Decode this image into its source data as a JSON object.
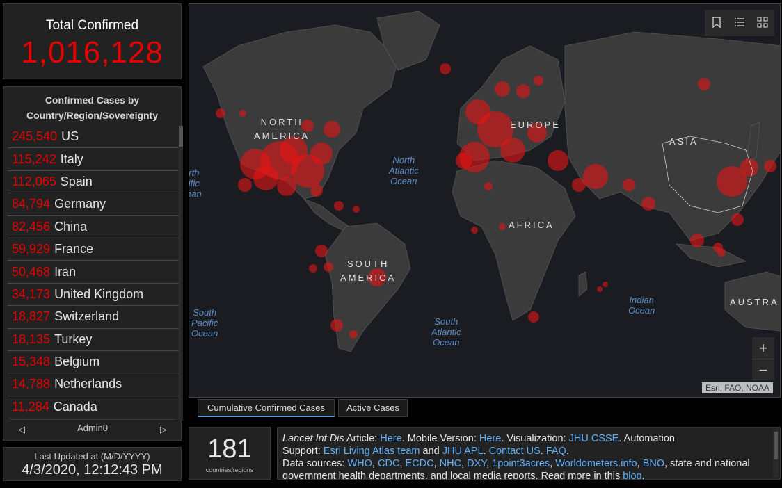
{
  "total": {
    "label": "Total Confirmed",
    "value": "1,016,128"
  },
  "country_list": {
    "header": "Confirmed Cases by Country/Region/Sovereignty",
    "rows": [
      {
        "count": "245,540",
        "name": "US"
      },
      {
        "count": "115,242",
        "name": "Italy"
      },
      {
        "count": "112,065",
        "name": "Spain"
      },
      {
        "count": "84,794",
        "name": "Germany"
      },
      {
        "count": "82,456",
        "name": "China"
      },
      {
        "count": "59,929",
        "name": "France"
      },
      {
        "count": "50,468",
        "name": "Iran"
      },
      {
        "count": "34,173",
        "name": "United Kingdom"
      },
      {
        "count": "18,827",
        "name": "Switzerland"
      },
      {
        "count": "18,135",
        "name": "Turkey"
      },
      {
        "count": "15,348",
        "name": "Belgium"
      },
      {
        "count": "14,788",
        "name": "Netherlands"
      },
      {
        "count": "11,284",
        "name": "Canada"
      }
    ],
    "pager_label": "Admin0"
  },
  "last_updated": {
    "label": "Last Updated at (M/D/YYYY)",
    "value": "4/3/2020, 12:12:43 PM"
  },
  "map": {
    "continent_labels": {
      "north_america": "NORTH AMERICA",
      "south_america": "SOUTH AMERICA",
      "europe": "EUROPE",
      "asia": "ASIA",
      "africa": "AFRICA",
      "australia": "AUSTRA"
    },
    "ocean_labels": {
      "north_atlantic": "North\nAtlantic\nOcean",
      "south_atlantic": "South\nAtlantic\nOcean",
      "south_pacific": "South\nPacific\nOcean",
      "north_pacific": "rth\nific\nean",
      "indian": "Indian\nOcean"
    },
    "attribution": "Esri, FAO, NOAA",
    "tools": [
      "bookmark-icon",
      "legend-list-icon",
      "qr-code-icon"
    ],
    "zoom_in": "+",
    "zoom_out": "−"
  },
  "tabs": {
    "cumulative": "Cumulative Confirmed Cases",
    "active": "Active Cases"
  },
  "countries_count": {
    "value": "181",
    "label": "countries/regions"
  },
  "info": {
    "article_source": "Lancet Inf Dis",
    "article_text": " Article: ",
    "here1": "Here",
    "mobile_text": ". Mobile Version: ",
    "here2": "Here",
    "viz_text": ". Visualization: ",
    "jhu_csse": "JHU CSSE",
    "automation_text": ". Automation",
    "support_text": "Support: ",
    "esri_team": "Esri Living Atlas team",
    "and_text": " and ",
    "jhu_apl": "JHU APL",
    "dot": ". ",
    "contact": "Contact US",
    "dot2": ". ",
    "faq": "FAQ",
    "dot3": ".",
    "sources_text": "Data sources: ",
    "sources": [
      "WHO",
      "CDC",
      "ECDC",
      "NHC",
      "DXY",
      "1point3acres",
      "Worldometers.info",
      "BNO"
    ],
    "sources_tail": ", state and national",
    "line4": "government health departments, and local media reports.  Read more in this ",
    "blog": "blog",
    "dot4": "."
  },
  "colors": {
    "accent_red": "#e60000",
    "link_blue": "#5db0ff",
    "panel_bg": "#222222",
    "map_bg": "#1a1c22",
    "land": "#3b3b3b"
  }
}
